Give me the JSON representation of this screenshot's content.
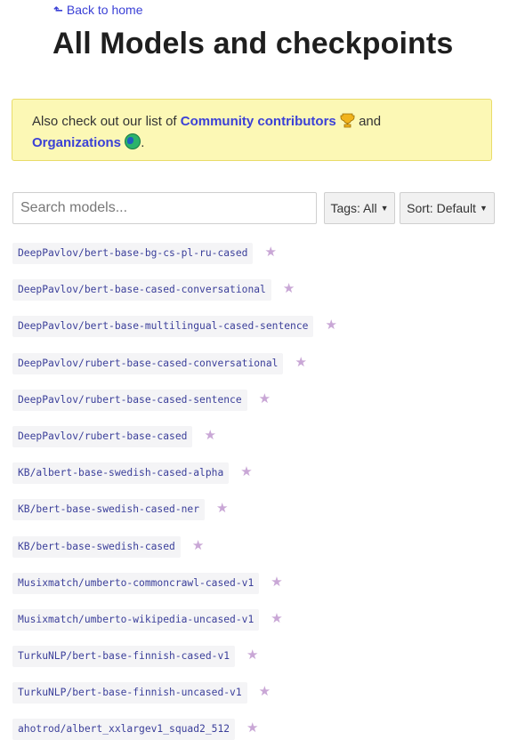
{
  "nav": {
    "back_label": "Back to home"
  },
  "page": {
    "title": "All Models and checkpoints"
  },
  "notice": {
    "prefix": "Also check out our list of",
    "community_link": "Community contributors",
    "middle": "and",
    "org_link": "Organizations",
    "suffix": "."
  },
  "search": {
    "placeholder": "Search models..."
  },
  "filters": {
    "tags_label": "Tags: All",
    "sort_label": "Sort: Default"
  },
  "colors": {
    "link": "#3b41d6",
    "notice_bg": "#fcf8b5",
    "star": "#c9a7d6"
  },
  "models": [
    "DeepPavlov/bert-base-bg-cs-pl-ru-cased",
    "DeepPavlov/bert-base-cased-conversational",
    "DeepPavlov/bert-base-multilingual-cased-sentence",
    "DeepPavlov/rubert-base-cased-conversational",
    "DeepPavlov/rubert-base-cased-sentence",
    "DeepPavlov/rubert-base-cased",
    "KB/albert-base-swedish-cased-alpha",
    "KB/bert-base-swedish-cased-ner",
    "KB/bert-base-swedish-cased",
    "Musixmatch/umberto-commoncrawl-cased-v1",
    "Musixmatch/umberto-wikipedia-uncased-v1",
    "TurkuNLP/bert-base-finnish-cased-v1",
    "TurkuNLP/bert-base-finnish-uncased-v1",
    "ahotrod/albert_xxlargev1_squad2_512"
  ]
}
